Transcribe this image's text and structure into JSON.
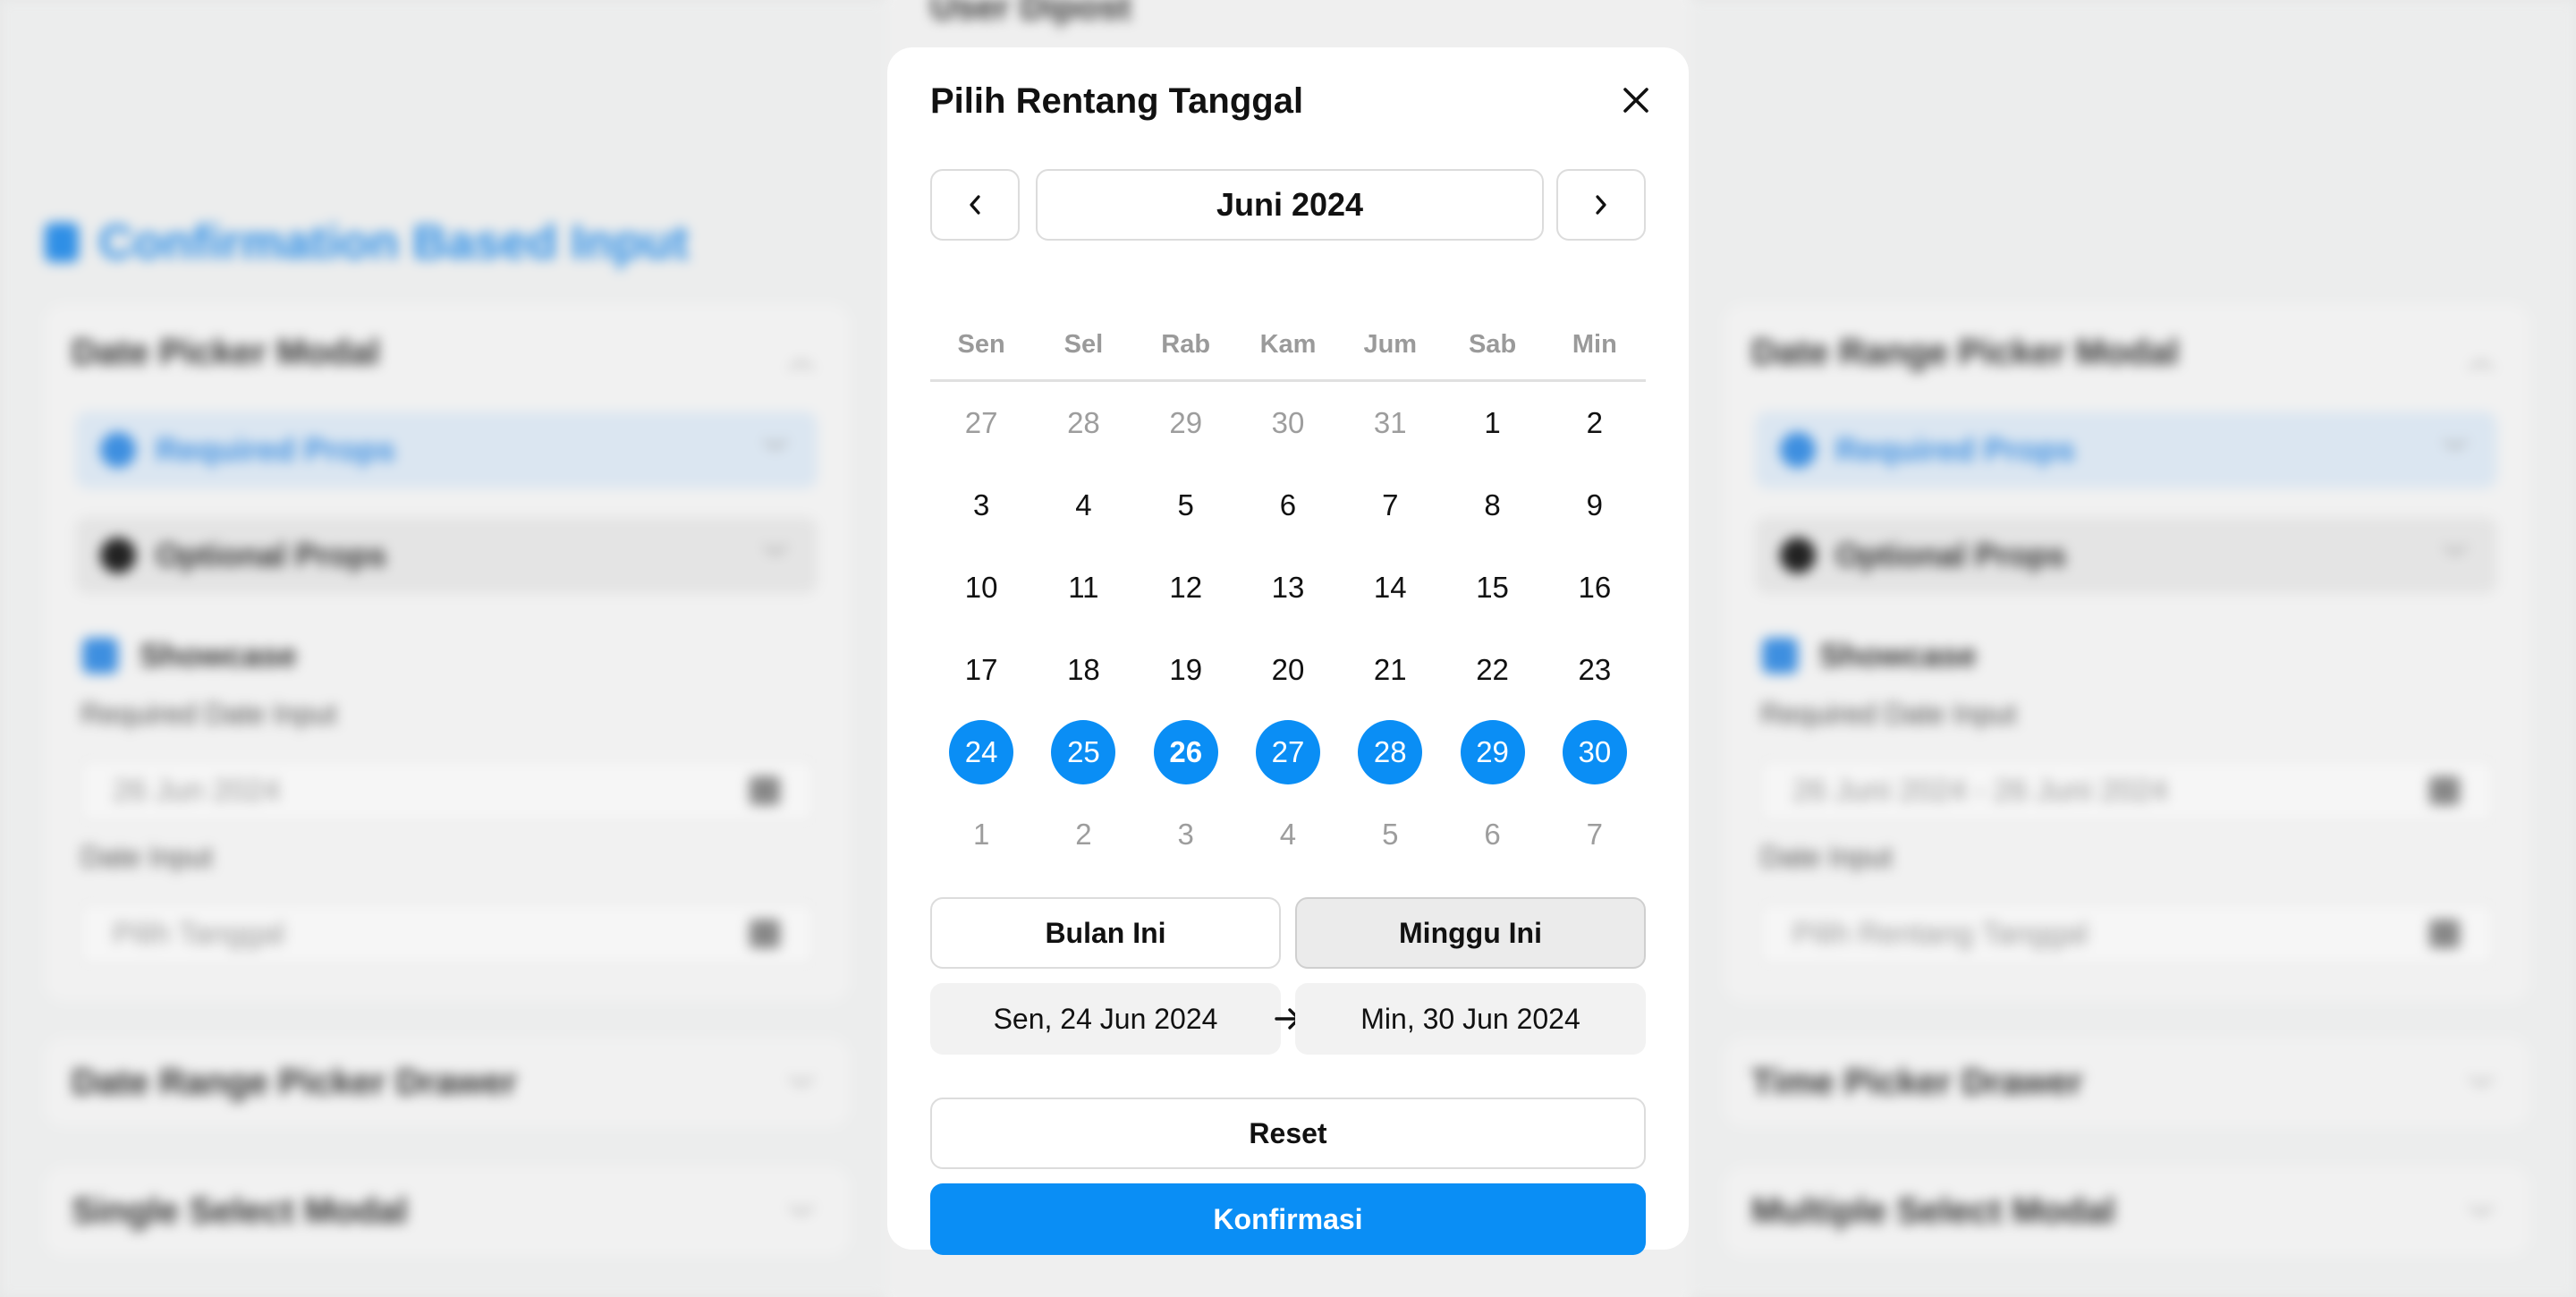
{
  "background": {
    "center_top_text": "User Dipost",
    "section_title": "Confirmation Based Input",
    "left_card": {
      "title": "Date Picker Modal",
      "required_props": "Required Props",
      "optional_props": "Optional Props",
      "showcase": "Showcase",
      "required_label": "Required Date Input",
      "required_value": "26 Jun 2024",
      "date_label": "Date Input",
      "date_placeholder": "Pilih Tanggal"
    },
    "right_card": {
      "title": "Date Range Picker Modal",
      "required_props": "Required Props",
      "optional_props": "Optional Props",
      "showcase": "Showcase",
      "required_label": "Required Date Input",
      "required_value": "26 Juni 2024 - 26 Juni 2024",
      "date_label": "Date Input",
      "date_placeholder": "Pilih Rentang Tanggal"
    },
    "left_collapsed": [
      "Date Range Picker Drawer",
      "Single Select Modal"
    ],
    "right_collapsed": [
      "Time Picker Drawer",
      "Multiple Select Modal"
    ]
  },
  "modal": {
    "title": "Pilih Rentang Tanggal",
    "month": "Juni 2024",
    "weekdays": [
      "Sen",
      "Sel",
      "Rab",
      "Kam",
      "Jum",
      "Sab",
      "Min"
    ],
    "days": [
      {
        "label": "27",
        "state": "muted"
      },
      {
        "label": "28",
        "state": "muted"
      },
      {
        "label": "29",
        "state": "muted"
      },
      {
        "label": "30",
        "state": "muted"
      },
      {
        "label": "31",
        "state": "muted"
      },
      {
        "label": "1",
        "state": "normal"
      },
      {
        "label": "2",
        "state": "normal"
      },
      {
        "label": "3",
        "state": "normal"
      },
      {
        "label": "4",
        "state": "normal"
      },
      {
        "label": "5",
        "state": "normal"
      },
      {
        "label": "6",
        "state": "normal"
      },
      {
        "label": "7",
        "state": "normal"
      },
      {
        "label": "8",
        "state": "normal"
      },
      {
        "label": "9",
        "state": "normal"
      },
      {
        "label": "10",
        "state": "normal"
      },
      {
        "label": "11",
        "state": "normal"
      },
      {
        "label": "12",
        "state": "normal"
      },
      {
        "label": "13",
        "state": "normal"
      },
      {
        "label": "14",
        "state": "normal"
      },
      {
        "label": "15",
        "state": "normal"
      },
      {
        "label": "16",
        "state": "normal"
      },
      {
        "label": "17",
        "state": "normal"
      },
      {
        "label": "18",
        "state": "normal"
      },
      {
        "label": "19",
        "state": "normal"
      },
      {
        "label": "20",
        "state": "normal"
      },
      {
        "label": "21",
        "state": "normal"
      },
      {
        "label": "22",
        "state": "normal"
      },
      {
        "label": "23",
        "state": "normal"
      },
      {
        "label": "24",
        "state": "selected"
      },
      {
        "label": "25",
        "state": "selected"
      },
      {
        "label": "26",
        "state": "selected-today"
      },
      {
        "label": "27",
        "state": "selected"
      },
      {
        "label": "28",
        "state": "selected"
      },
      {
        "label": "29",
        "state": "selected"
      },
      {
        "label": "30",
        "state": "selected"
      },
      {
        "label": "1",
        "state": "muted"
      },
      {
        "label": "2",
        "state": "muted"
      },
      {
        "label": "3",
        "state": "muted"
      },
      {
        "label": "4",
        "state": "muted"
      },
      {
        "label": "5",
        "state": "muted"
      },
      {
        "label": "6",
        "state": "muted"
      },
      {
        "label": "7",
        "state": "muted"
      }
    ],
    "preset_month": "Bulan Ini",
    "preset_week": "Minggu Ini",
    "range_start": "Sen, 24 Jun 2024",
    "range_end": "Min, 30 Jun 2024",
    "reset": "Reset",
    "confirm": "Konfirmasi",
    "icons": {
      "close": "close-icon",
      "prev": "chevron-left-icon",
      "next": "chevron-right-icon",
      "arrow": "arrow-right-icon"
    },
    "colors": {
      "accent": "#0a8ef5",
      "muted_text": "#9d9d9d"
    }
  }
}
